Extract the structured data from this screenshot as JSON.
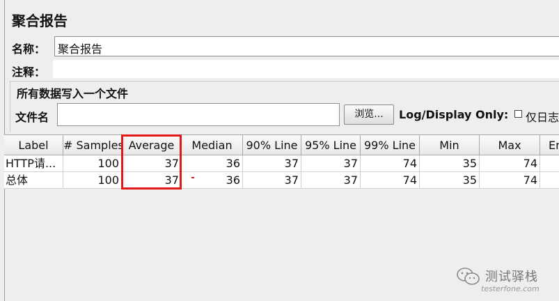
{
  "panel": {
    "title": "聚合报告",
    "name_label": "名称：",
    "name_value": "聚合报告",
    "comment_label": "注释：",
    "comment_value": ""
  },
  "file_group": {
    "title": "所有数据写入一个文件",
    "filename_label": "文件名",
    "filename_value": "",
    "browse_label": "浏览...",
    "log_display_label": "Log/Display Only:",
    "errors_only_label": "仅日志"
  },
  "table": {
    "columns": [
      "Label",
      "# Samples",
      "Average",
      "Median",
      "90% Line",
      "95% Line",
      "99% Line",
      "Min",
      "Max",
      "Er"
    ],
    "rows": [
      [
        "HTTP请...",
        "100",
        "37",
        "36",
        "37",
        "37",
        "74",
        "35",
        "74",
        ""
      ],
      [
        "总体",
        "100",
        "37",
        "36",
        "37",
        "37",
        "74",
        "35",
        "74",
        ""
      ]
    ]
  },
  "watermark": {
    "name": "测试驿栈",
    "url": "testerfone.com",
    "icon": "wechat-icon"
  },
  "colors": {
    "highlight": "#e01818"
  }
}
